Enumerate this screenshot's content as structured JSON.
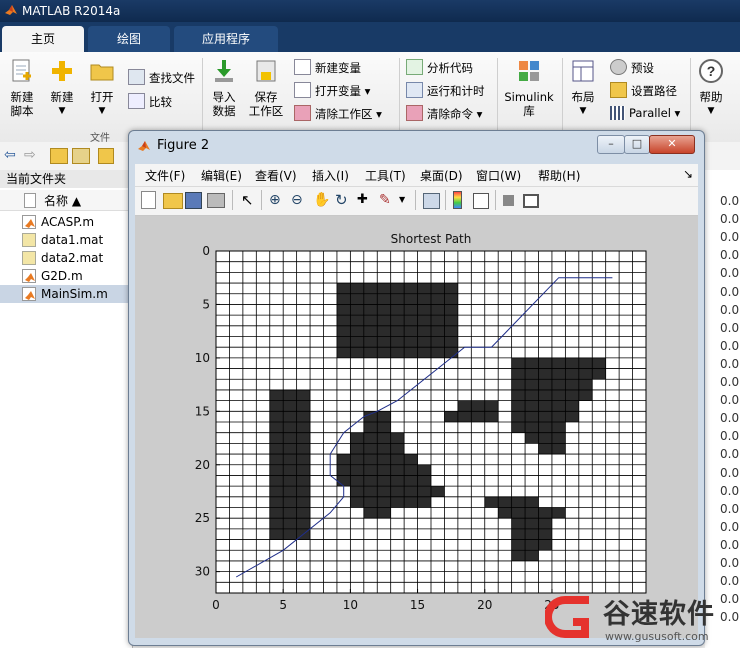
{
  "app": {
    "title": "MATLAB R2014a"
  },
  "tabs": [
    {
      "label": "主页"
    },
    {
      "label": "绘图"
    },
    {
      "label": "应用程序"
    }
  ],
  "ribbon": {
    "new_script": [
      "新建",
      "脚本"
    ],
    "new": "新建",
    "open": "打开",
    "find_files": "查找文件",
    "compare": "比较",
    "group_file": "文件",
    "import": [
      "导入",
      "数据"
    ],
    "save_ws": [
      "保存",
      "工作区"
    ],
    "new_var": "新建变量",
    "open_var": "打开变量",
    "clear_ws": "清除工作区",
    "analyze": "分析代码",
    "run_time": "运行和计时",
    "clear_cmd": "清除命令",
    "simulink": [
      "Simulink",
      "库"
    ],
    "layout": "布局",
    "prefs": "预设",
    "set_path": "设置路径",
    "parallel": "Parallel",
    "help": "帮助"
  },
  "left_panel": {
    "title": "当前文件夹",
    "col_name": "名称 ▲",
    "files": [
      {
        "name": "ACASP.m",
        "kind": "m"
      },
      {
        "name": "data1.mat",
        "kind": "mat"
      },
      {
        "name": "data2.mat",
        "kind": "mat"
      },
      {
        "name": "G2D.m",
        "kind": "m"
      },
      {
        "name": "MainSim.m",
        "kind": "m",
        "selected": true
      }
    ]
  },
  "right_values": [
    "0.0",
    "0.0",
    "0.0",
    "0.0",
    "0.0",
    "0.0",
    "0.0",
    "0.0",
    "0.0",
    "0.0",
    "0.0",
    "0.0",
    "0.0",
    "0.0",
    "0.0",
    "0.0",
    "0.0",
    "0.0",
    "0.0",
    "0.0",
    "0.0",
    "0.0",
    "0.0",
    "0.0"
  ],
  "figure": {
    "title": "Figure 2",
    "menu": [
      "文件(F)",
      "编辑(E)",
      "查看(V)",
      "插入(I)",
      "工具(T)",
      "桌面(D)",
      "窗口(W)",
      "帮助(H)"
    ],
    "menu_arrow": "↘",
    "win_buttons": {
      "min": "–",
      "max": "□",
      "close": "✕"
    }
  },
  "chart_data": {
    "type": "heatmap",
    "title": "Shortest Path",
    "grid_size": 32,
    "x_ticks": [
      0,
      5,
      10,
      15,
      20,
      25
    ],
    "y_ticks": [
      0,
      5,
      10,
      15,
      20,
      25,
      30
    ],
    "xlim": [
      0,
      32
    ],
    "ylim": [
      0,
      32
    ],
    "y_reversed": true,
    "grid": true,
    "obstacle_color": "#2b2b2b",
    "free_color": "#ffffff",
    "path_color": "#1f2e8a",
    "obstacles": [
      {
        "rows": [
          3,
          9
        ],
        "cols": [
          9,
          17
        ]
      },
      {
        "rows": [
          14,
          14
        ],
        "cols": [
          18,
          20
        ]
      },
      {
        "rows": [
          15,
          15
        ],
        "cols": [
          17,
          20
        ]
      },
      {
        "rows": [
          13,
          26
        ],
        "cols": [
          4,
          6
        ]
      },
      {
        "rows": [
          15,
          16
        ],
        "cols": [
          11,
          12
        ]
      },
      {
        "rows": [
          17,
          18
        ],
        "cols": [
          10,
          13
        ]
      },
      {
        "rows": [
          19,
          19
        ],
        "cols": [
          9,
          14
        ]
      },
      {
        "rows": [
          20,
          21
        ],
        "cols": [
          9,
          15
        ]
      },
      {
        "rows": [
          22,
          22
        ],
        "cols": [
          10,
          16
        ]
      },
      {
        "rows": [
          23,
          23
        ],
        "cols": [
          10,
          15
        ]
      },
      {
        "rows": [
          24,
          24
        ],
        "cols": [
          11,
          12
        ]
      },
      {
        "rows": [
          10,
          11
        ],
        "cols": [
          22,
          28
        ]
      },
      {
        "rows": [
          12,
          13
        ],
        "cols": [
          22,
          27
        ]
      },
      {
        "rows": [
          14,
          15
        ],
        "cols": [
          22,
          26
        ]
      },
      {
        "rows": [
          16,
          16
        ],
        "cols": [
          22,
          25
        ]
      },
      {
        "rows": [
          17,
          17
        ],
        "cols": [
          23,
          25
        ]
      },
      {
        "rows": [
          18,
          18
        ],
        "cols": [
          24,
          25
        ]
      },
      {
        "rows": [
          23,
          23
        ],
        "cols": [
          20,
          23
        ]
      },
      {
        "rows": [
          24,
          24
        ],
        "cols": [
          21,
          25
        ]
      },
      {
        "rows": [
          25,
          25
        ],
        "cols": [
          22,
          24
        ]
      },
      {
        "rows": [
          26,
          27
        ],
        "cols": [
          22,
          24
        ]
      },
      {
        "rows": [
          28,
          28
        ],
        "cols": [
          22,
          23
        ]
      }
    ],
    "path": [
      [
        1.5,
        30.5
      ],
      [
        5,
        28
      ],
      [
        8.5,
        24.5
      ],
      [
        9.5,
        23
      ],
      [
        9.5,
        22
      ],
      [
        8.5,
        21
      ],
      [
        8.5,
        19
      ],
      [
        9.5,
        17
      ],
      [
        10.5,
        16
      ],
      [
        11,
        15.5
      ],
      [
        12,
        15
      ],
      [
        13.5,
        14
      ],
      [
        16.5,
        11
      ],
      [
        18.5,
        9
      ],
      [
        20.5,
        9
      ],
      [
        25.5,
        2.5
      ],
      [
        29.5,
        2.5
      ]
    ]
  },
  "watermark": {
    "brand": "谷速软件",
    "url": "www.gususoft.com"
  }
}
